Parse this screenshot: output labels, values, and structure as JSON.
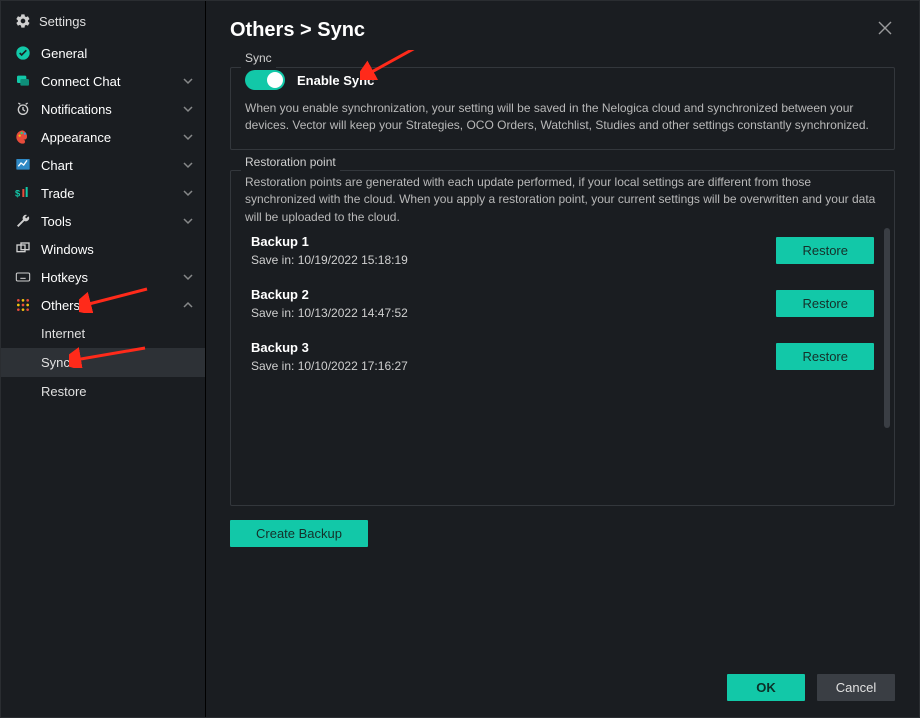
{
  "header": {
    "settings_label": "Settings"
  },
  "sidebar": {
    "items": [
      {
        "label": "General"
      },
      {
        "label": "Connect Chat"
      },
      {
        "label": "Notifications"
      },
      {
        "label": "Appearance"
      },
      {
        "label": "Chart"
      },
      {
        "label": "Trade"
      },
      {
        "label": "Tools"
      },
      {
        "label": "Windows"
      },
      {
        "label": "Hotkeys"
      },
      {
        "label": "Others"
      }
    ],
    "others_sub": [
      {
        "label": "Internet"
      },
      {
        "label": "Sync"
      },
      {
        "label": "Restore"
      }
    ]
  },
  "content": {
    "breadcrumb": "Others > Sync",
    "sync_panel": {
      "title": "Sync",
      "toggle_label": "Enable Sync",
      "toggle_on": true,
      "description": "When you enable synchronization, your setting will be saved in the Nelogica cloud and synchronized between your devices. Vector will keep your Strategies, OCO Orders, Watchlist, Studies and other settings constantly synchronized."
    },
    "restore_panel": {
      "title": "Restoration point",
      "description": "Restoration points are generated with each update performed, if your local settings are different from those synchronized with the cloud. When you apply a restoration point, your current settings will be overwritten and your data will be uploaded to the cloud.",
      "save_in_prefix": "Save in: ",
      "restore_label": "Restore",
      "backups": [
        {
          "name": "Backup 1",
          "saved": "10/19/2022 15:18:19"
        },
        {
          "name": "Backup 2",
          "saved": "10/13/2022 14:47:52"
        },
        {
          "name": "Backup 3",
          "saved": "10/10/2022 17:16:27"
        }
      ],
      "create_label": "Create Backup"
    }
  },
  "footer": {
    "ok": "OK",
    "cancel": "Cancel"
  },
  "colors": {
    "accent": "#12c8a8",
    "bg": "#1a1d21",
    "panel_border": "#33373c"
  }
}
